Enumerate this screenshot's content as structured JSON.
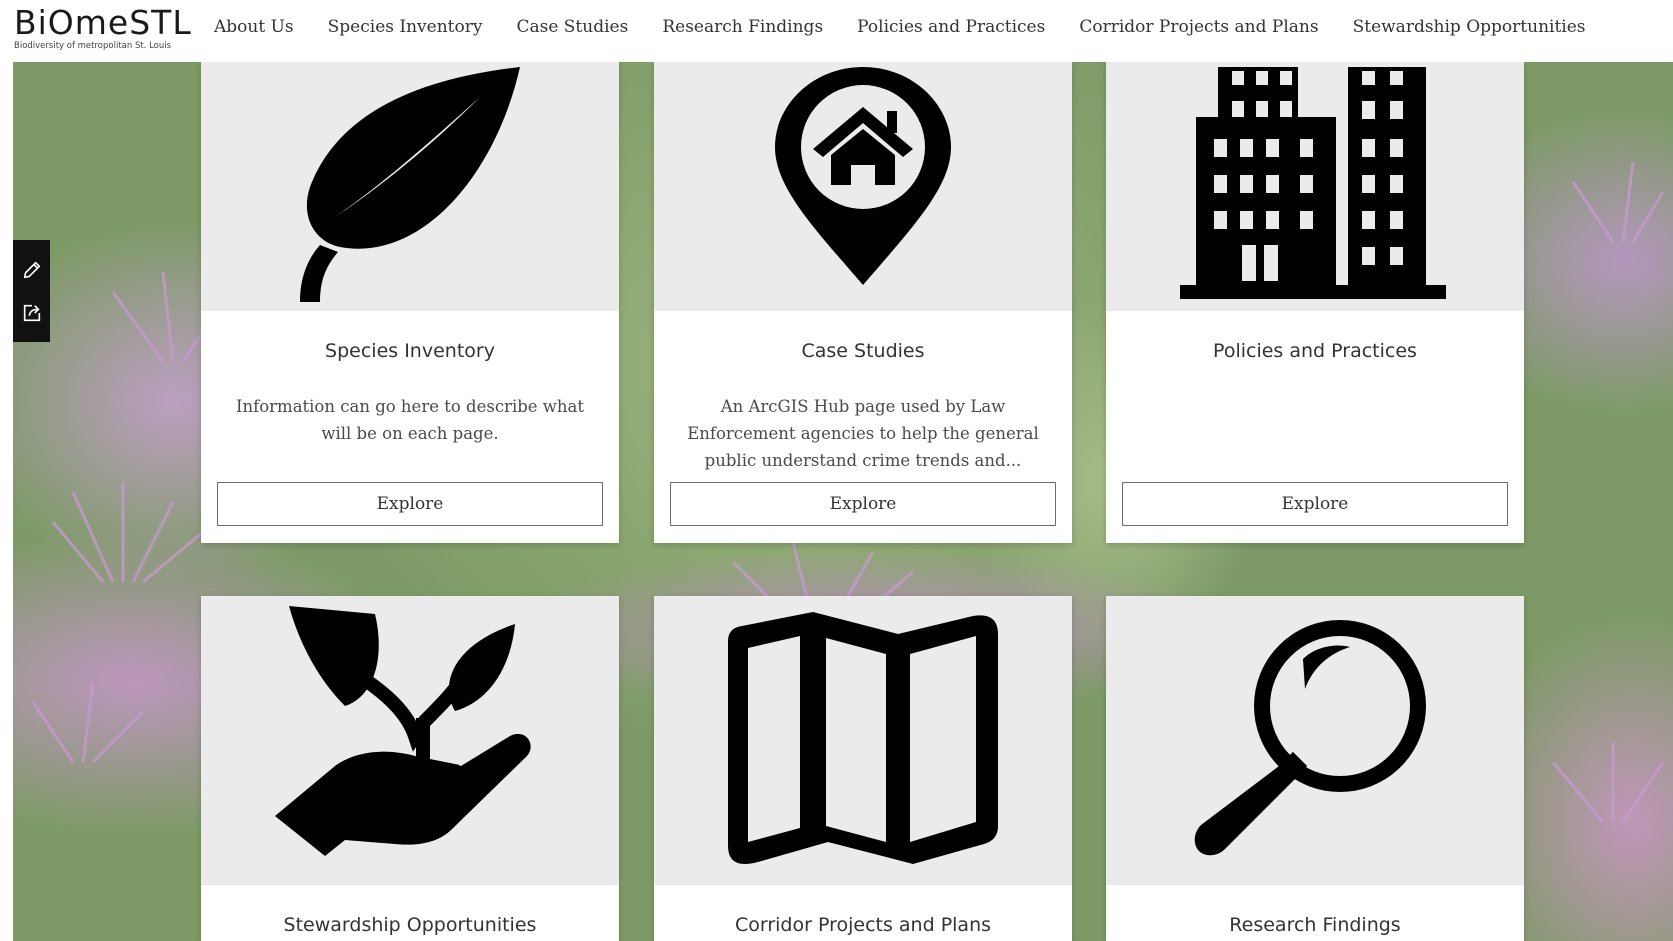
{
  "brand": {
    "logo_text": "BiOmeSTL",
    "tagline": "Biodiversity of metropolitan St. Louis"
  },
  "nav": {
    "items": [
      "About Us",
      "Species Inventory",
      "Case Studies",
      "Research Findings",
      "Policies and Practices",
      "Corridor Projects and Plans",
      "Stewardship Opportunities"
    ]
  },
  "toolbar": {
    "icons": [
      "pencil-icon",
      "share-icon"
    ]
  },
  "cards": [
    {
      "title": "Species Inventory",
      "description": "Information can go here to describe what will be on each page.",
      "button": "Explore",
      "icon": "leaf-icon"
    },
    {
      "title": "Case Studies",
      "description": "An ArcGIS Hub page used by Law Enforcement agencies to help the general public understand crime trends and...",
      "button": "Explore",
      "icon": "home-pin-icon"
    },
    {
      "title": "Policies and Practices",
      "description": "",
      "button": "Explore",
      "icon": "buildings-icon"
    },
    {
      "title": "Stewardship Opportunities",
      "icon": "hand-plant-icon"
    },
    {
      "title": "Corridor Projects and Plans",
      "icon": "map-icon"
    },
    {
      "title": "Research Findings",
      "icon": "magnifier-icon"
    }
  ],
  "colors": {
    "icon": "#000000",
    "card_media_bg": "#ebebeb",
    "toolbar_bg": "#111111"
  }
}
